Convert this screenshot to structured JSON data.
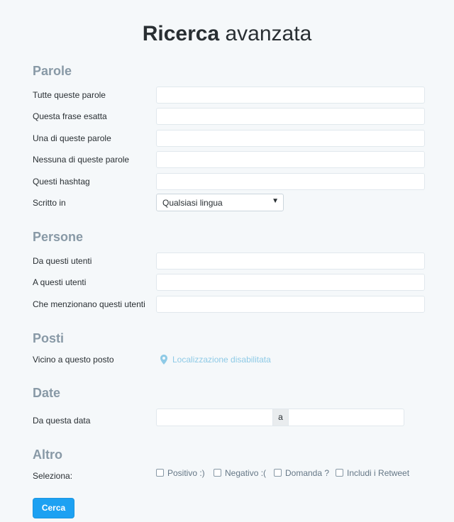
{
  "title": {
    "bold": "Ricerca",
    "light": "avanzata"
  },
  "sections": {
    "words": {
      "heading": "Parole",
      "all_words": "Tutte queste parole",
      "exact_phrase": "Questa frase esatta",
      "any_words": "Una di queste parole",
      "none_words": "Nessuna di queste parole",
      "hashtags": "Questi hashtag",
      "language_label": "Scritto in",
      "language_value": "Qualsiasi lingua"
    },
    "people": {
      "heading": "Persone",
      "from": "Da questi utenti",
      "to": "A questi utenti",
      "mentioning": "Che menzionano questi utenti"
    },
    "places": {
      "heading": "Posti",
      "near": "Vicino a questo posto",
      "location_link": "Localizzazione disabilitata"
    },
    "dates": {
      "heading": "Date",
      "from_date": "Da questa data",
      "separator": "a"
    },
    "other": {
      "heading": "Altro",
      "select_label": "Seleziona:",
      "positive": "Positivo :)",
      "negative": "Negativo :(",
      "question": "Domanda ?",
      "retweets": "Includi i Retweet"
    }
  },
  "submit_label": "Cerca"
}
